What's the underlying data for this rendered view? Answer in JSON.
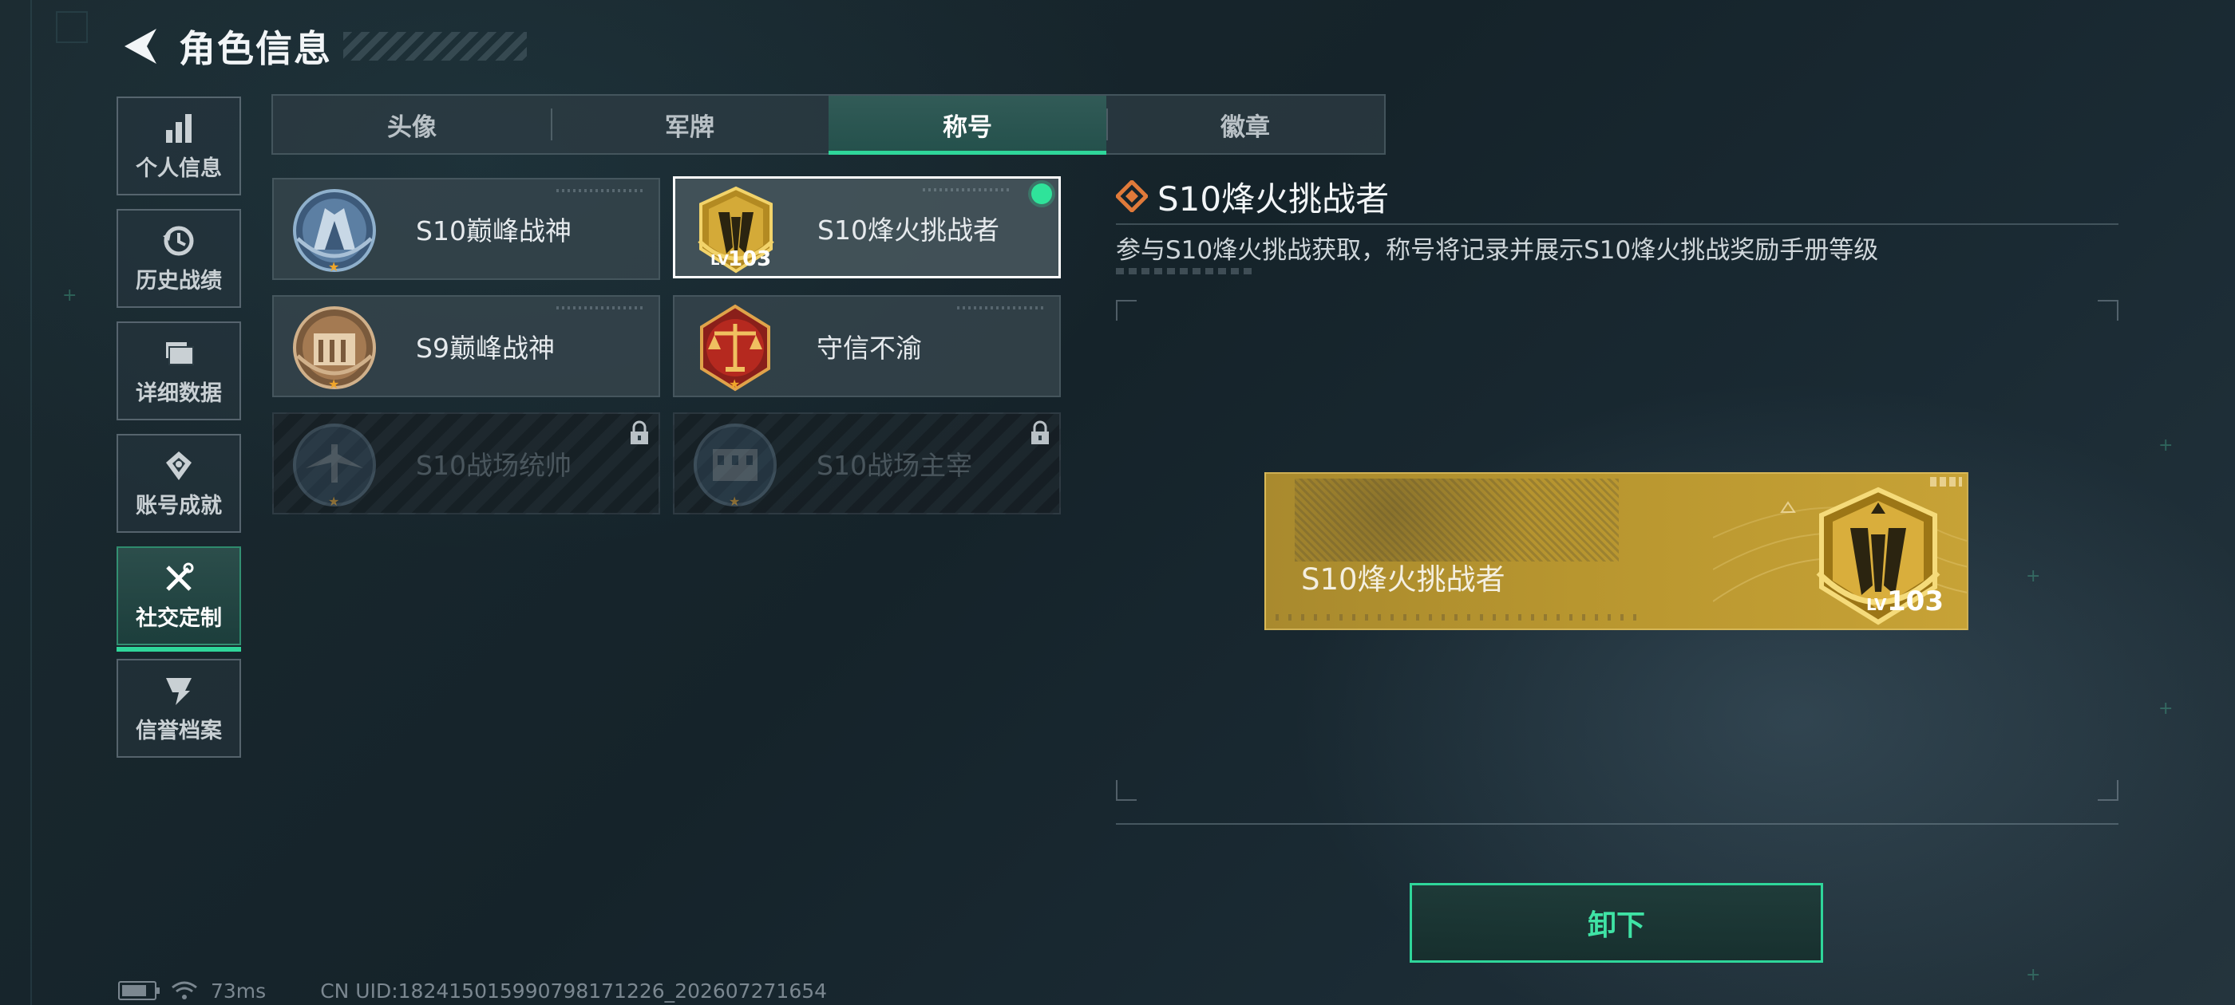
{
  "header": {
    "title": "角色信息"
  },
  "sidebar": {
    "items": [
      {
        "label": "个人信息",
        "icon": "bar-chart-icon"
      },
      {
        "label": "历史战绩",
        "icon": "history-icon"
      },
      {
        "label": "详细数据",
        "icon": "folder-icon"
      },
      {
        "label": "账号成就",
        "icon": "achievement-icon"
      },
      {
        "label": "社交定制",
        "icon": "tools-icon",
        "active": true
      },
      {
        "label": "信誉档案",
        "icon": "credit-icon"
      }
    ]
  },
  "tabs": [
    {
      "label": "头像"
    },
    {
      "label": "军牌"
    },
    {
      "label": "称号",
      "active": true
    },
    {
      "label": "徽章"
    }
  ],
  "titles": [
    {
      "name": "S10巅峰战神",
      "state": "unlocked"
    },
    {
      "name": "S10烽火挑战者",
      "state": "selected",
      "level": "103",
      "level_prefix": "LV"
    },
    {
      "name": "S9巅峰战神",
      "state": "unlocked"
    },
    {
      "name": "守信不渝",
      "state": "unlocked"
    },
    {
      "name": "S10战场统帅",
      "state": "locked"
    },
    {
      "name": "S10战场主宰",
      "state": "locked"
    }
  ],
  "detail": {
    "title": "S10烽火挑战者",
    "description": "参与S10烽火挑战获取，称号将记录并展示S10烽火挑战奖励手册等级",
    "banner_label": "S10烽火挑战者",
    "banner_level_prefix": "LV",
    "banner_level": "103",
    "action_label": "卸下"
  },
  "status": {
    "ping": "73ms",
    "uid": "CN UID:1824150159907981712​26_202607271654"
  },
  "colors": {
    "accent_green": "#2fd69a",
    "gold": "#c7a236",
    "detail_diamond": "#e07a3a"
  }
}
